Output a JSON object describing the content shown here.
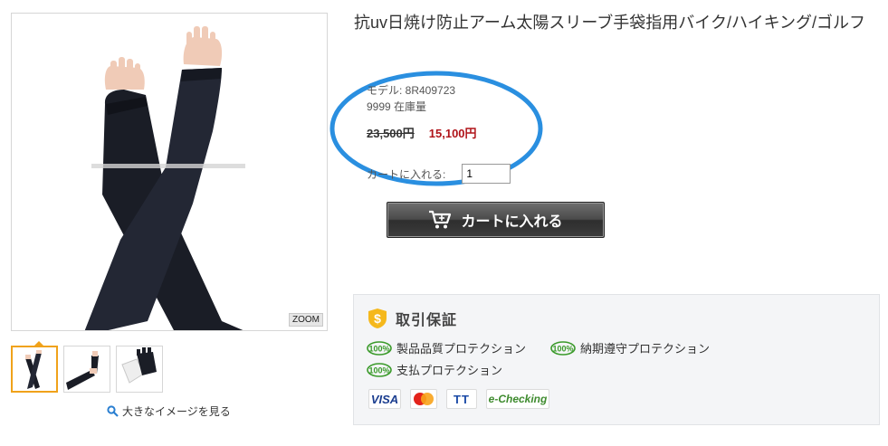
{
  "gallery": {
    "zoom_label": "ZOOM",
    "larger_image_link": "大きなイメージを見る",
    "thumbnails": [
      "arm-sleeves-crossed",
      "arm-sleeve-side",
      "gloves-pair"
    ]
  },
  "product": {
    "title": "抗uv日焼け防止アーム太陽スリーブ手袋指用バイク/ハイキング/ゴルフ",
    "model": "モデル: 8R409723",
    "stock": "9999 在庫量",
    "old_price": "23,500円",
    "new_price": "15,100円",
    "qty_label": "カートに入れる:",
    "qty_value": "1",
    "cart_button_label": "カートに入れる"
  },
  "guarantee": {
    "title": "取引保証",
    "badge": "100%",
    "items": [
      "製品品質プロテクション",
      "納期遵守プロテクション",
      "支払プロテクション"
    ],
    "payments": [
      "VISA",
      "MasterCard",
      "TT",
      "e-Checking"
    ]
  },
  "colors": {
    "price_red": "#b0141a",
    "highlight_blue": "#2a8fe0",
    "thumb_active": "#f0a21a",
    "badge_green": "#3a9a2a"
  }
}
